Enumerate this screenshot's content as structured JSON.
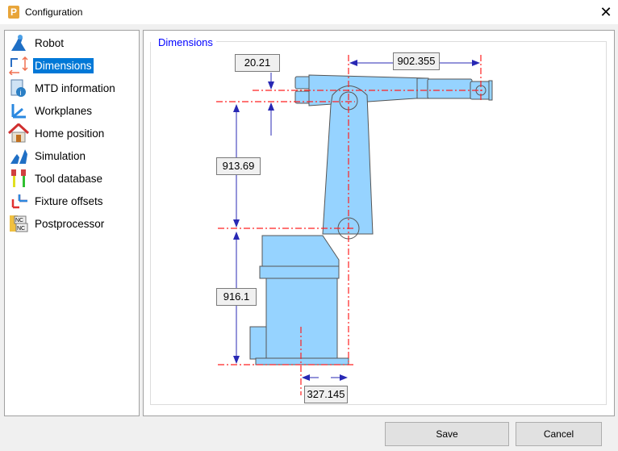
{
  "window": {
    "title": "Configuration",
    "icon": "app-p-icon",
    "close": "✕"
  },
  "sidebar": {
    "items": [
      {
        "label": "Robot",
        "icon": "robot-icon"
      },
      {
        "label": "Dimensions",
        "icon": "dimensions-icon",
        "selected": true
      },
      {
        "label": "MTD information",
        "icon": "info-document-icon"
      },
      {
        "label": "Workplanes",
        "icon": "workplanes-icon"
      },
      {
        "label": "Home position",
        "icon": "home-icon"
      },
      {
        "label": "Simulation",
        "icon": "simulation-icon"
      },
      {
        "label": "Tool database",
        "icon": "tool-database-icon"
      },
      {
        "label": "Fixture offsets",
        "icon": "fixture-offsets-icon"
      },
      {
        "label": "Postprocessor",
        "icon": "postprocessor-icon"
      }
    ]
  },
  "main": {
    "group_title": "Dimensions",
    "dimensions": {
      "tool_offset": "20.21",
      "forearm_length": "902.355",
      "upper_arm_length": "913.69",
      "base_height": "916.1",
      "base_offset": "327.145"
    }
  },
  "colors": {
    "accent": "#0078d7",
    "robot_fill": "#96d3ff",
    "dim_line": "#ff0000",
    "arrow": "#2828b4",
    "legend": "#0000ff"
  },
  "footer": {
    "save": "Save",
    "cancel": "Cancel"
  }
}
